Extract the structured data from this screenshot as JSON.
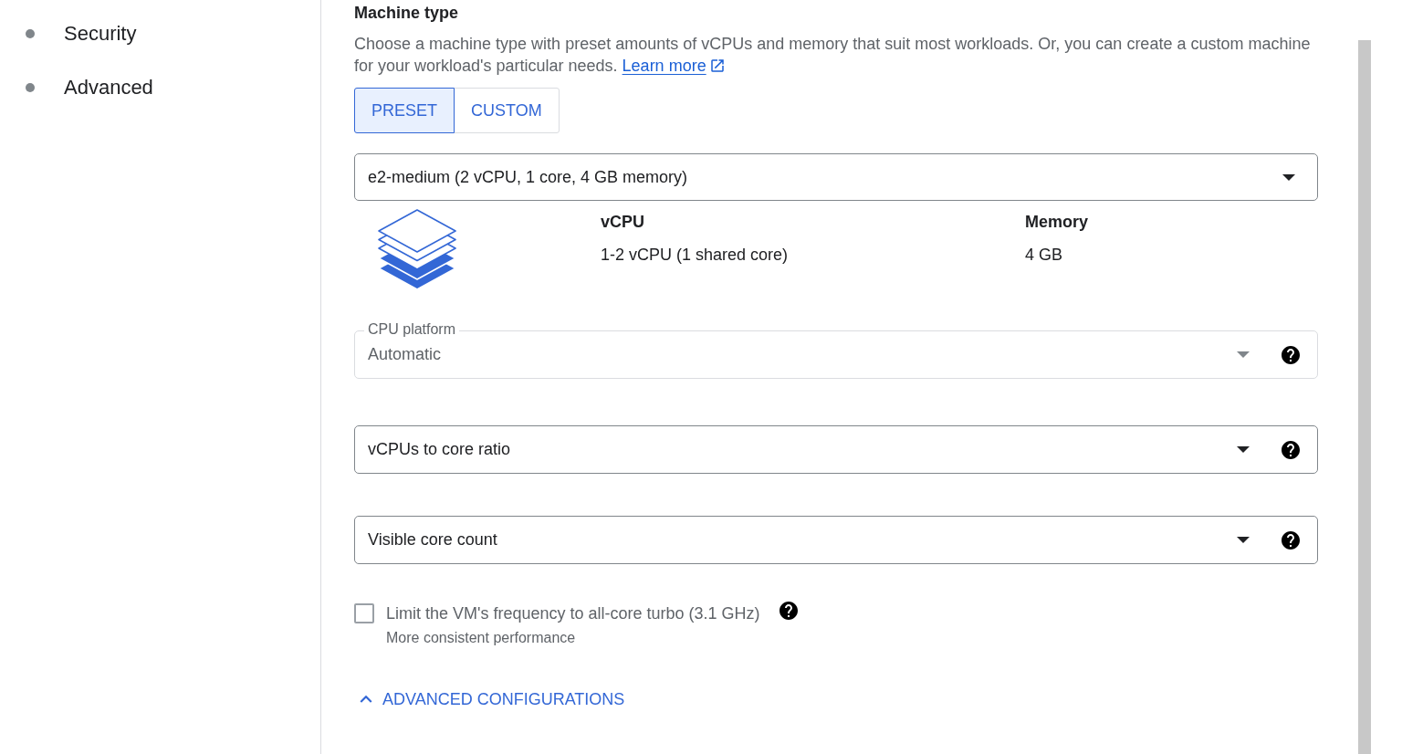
{
  "sidebar": {
    "items": [
      {
        "label": "Security"
      },
      {
        "label": "Advanced"
      }
    ]
  },
  "machine_type": {
    "title": "Machine type",
    "description": "Choose a machine type with preset amounts of vCPUs and memory that suit most workloads. Or, you can create a custom machine for your workload's particular needs.",
    "learn_more": "Learn more",
    "tabs": [
      {
        "label": "PRESET",
        "selected": true
      },
      {
        "label": "CUSTOM",
        "selected": false
      }
    ],
    "machine_select": {
      "value": "e2-medium (2 vCPU, 1 core, 4 GB memory)"
    },
    "specs": [
      {
        "heading": "vCPU",
        "value": "1-2 vCPU (1 shared core)"
      },
      {
        "heading": "Memory",
        "value": "4 GB"
      }
    ],
    "fields": [
      {
        "label": "CPU platform",
        "value": "Automatic",
        "disabled": true
      },
      {
        "label": "vCPUs to core ratio",
        "disabled": false
      },
      {
        "label": "Visible core count",
        "disabled": false
      }
    ],
    "frequency_limit": {
      "label": "Limit the VM's frequency to all-core turbo (3.1 GHz)",
      "hint": "More consistent performance",
      "checked": false
    },
    "advanced_toggle": {
      "label": "ADVANCED CONFIGURATIONS",
      "expanded": true
    }
  }
}
